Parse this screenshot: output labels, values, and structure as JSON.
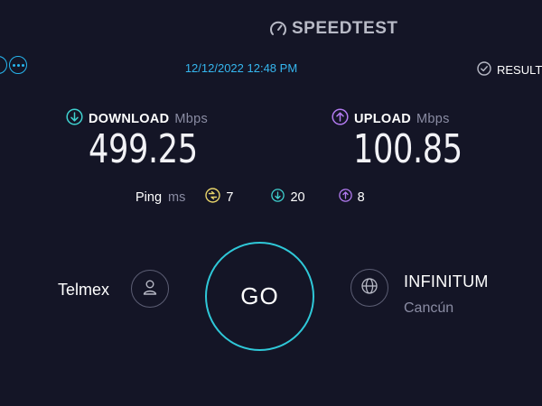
{
  "header": {
    "logo_text": "SPEEDTEST"
  },
  "top": {
    "datetime": "12/12/2022 12:48 PM",
    "results_label": "RESULTS"
  },
  "download": {
    "label": "DOWNLOAD",
    "unit": "Mbps",
    "value": "499.25"
  },
  "upload": {
    "label": "UPLOAD",
    "unit": "Mbps",
    "value": "100.85"
  },
  "ping": {
    "label": "Ping",
    "unit": "ms",
    "jitter": "7",
    "download_latency": "20",
    "upload_latency": "8"
  },
  "provider": {
    "isp": "Telmex",
    "go_label": "GO",
    "server": "INFINITUM",
    "location": "Cancún"
  },
  "colors": {
    "background": "#141526",
    "accent_blue": "#35b6ee",
    "download_teal": "#3fd1cf",
    "upload_purple": "#b27af0",
    "jitter_yellow": "#e8d46a",
    "go_ring": "#2fc8d8"
  }
}
